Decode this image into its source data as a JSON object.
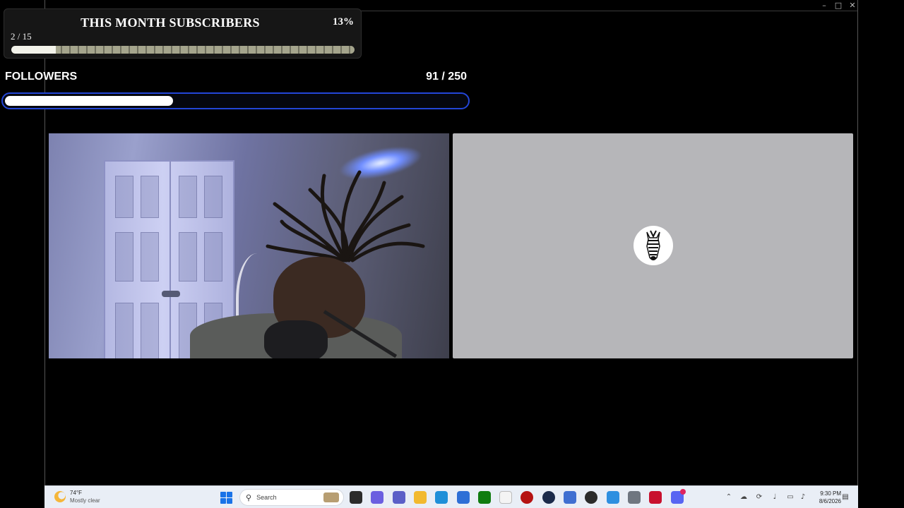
{
  "subscribers": {
    "title": "THIS MONTH SUBSCRIBERS",
    "percent": "13%",
    "count": "2 / 15",
    "progress_fraction": 0.13
  },
  "followers": {
    "label": "FOLLOWERS",
    "count": "91 / 250",
    "progress_fraction": 0.364
  },
  "video_tiles": [
    {
      "kind": "webcam",
      "icon": "webcam-feed"
    },
    {
      "kind": "avatar",
      "icon": "zebra-icon"
    }
  ],
  "window_controls": {
    "minimize": "–",
    "maximize": "□",
    "close": "✕"
  },
  "taskbar": {
    "weather_temp": "74°F",
    "weather_condition": "Mostly clear",
    "search_placeholder": "Search",
    "time": "9:30 PM",
    "date": "8/6/2026",
    "apps": [
      {
        "name": "task-view",
        "color": "#2b2b2b"
      },
      {
        "name": "copilot",
        "color": "#6b5fe0"
      },
      {
        "name": "teams",
        "color": "#5b5fc7"
      },
      {
        "name": "file-explorer",
        "color": "#f2b92f"
      },
      {
        "name": "edge",
        "color": "#1f8fd8"
      },
      {
        "name": "store",
        "color": "#2e6fd6"
      },
      {
        "name": "xbox",
        "color": "#107c10"
      },
      {
        "name": "notepad",
        "color": "#f4f4f4"
      },
      {
        "name": "record",
        "color": "#b51212"
      },
      {
        "name": "steam",
        "color": "#1b2a4a"
      },
      {
        "name": "remote-desktop",
        "color": "#3f6fd1"
      },
      {
        "name": "obs",
        "color": "#2b2b2b"
      },
      {
        "name": "network-tool",
        "color": "#2d8fe0"
      },
      {
        "name": "settings",
        "color": "#6f7680"
      },
      {
        "name": "mcafee",
        "color": "#c8102e"
      },
      {
        "name": "discord",
        "color": "#5865f2"
      }
    ]
  }
}
